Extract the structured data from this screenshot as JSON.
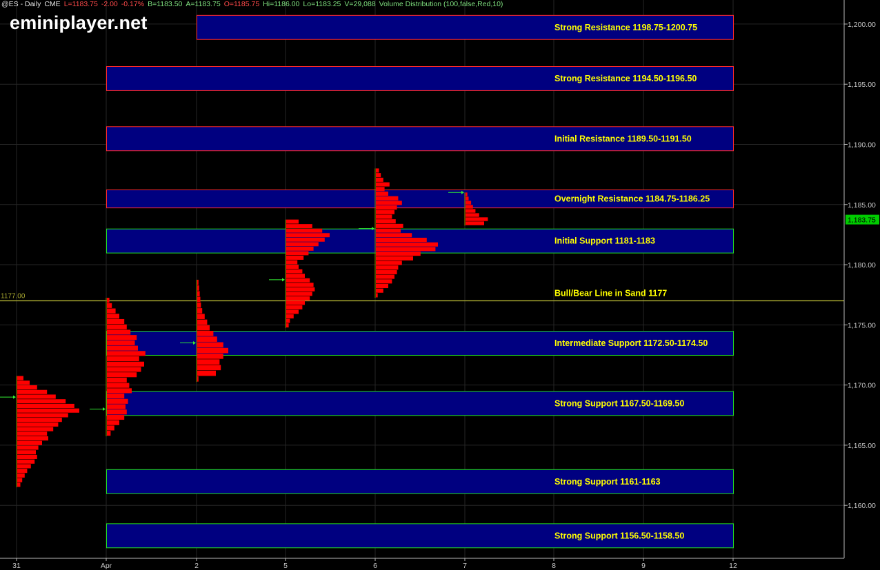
{
  "header": {
    "symbol": "@ES - Daily",
    "exchange": "CME",
    "last": "L=1183.75",
    "change": "-2.00",
    "change_pct": "-0.17%",
    "bid": "B=1183.50",
    "ask": "A=1183.75",
    "open": "O=1185.75",
    "high": "Hi=1186.00",
    "low": "Lo=1183.25",
    "volume": "V=29,088",
    "study": "Volume Distribution (100,false,Red,10)"
  },
  "watermark": "eminiplayer.net",
  "colors": {
    "zone_fill": "#000080",
    "resistance_border": "#ff2a2a",
    "support_border": "#22dd22",
    "zone_text": "#ffff00",
    "profile": "#ff0000",
    "poc_marker": "#33ee33",
    "line_in_sand": "#a8a830",
    "axis_text": "#c8c8c8",
    "last_price_tag": "#00cc00"
  },
  "chart_data": {
    "type": "volume-profile-levels",
    "x_labels": [
      "31",
      "Apr",
      "2",
      "5",
      "6",
      "7",
      "8",
      "9",
      "12"
    ],
    "y_ticks": [
      "1,160.00",
      "1,165.00",
      "1,170.00",
      "1,175.00",
      "1,180.00",
      "1,185.00",
      "1,190.00",
      "1,195.00",
      "1,200.00"
    ],
    "ylim": [
      1155.6,
      1202.0
    ],
    "last_price": 1183.75,
    "last_price_label": "1,183.75",
    "line_in_sand": {
      "value": 1177.0,
      "axis_label": "1177.00",
      "label": "Bull/Bear Line in Sand 1177"
    },
    "zones": [
      {
        "label": "Strong Resistance 1198.75-1200.75",
        "low": 1198.75,
        "high": 1200.75,
        "kind": "resistance",
        "start": "2"
      },
      {
        "label": "Strong Resistance 1194.50-1196.50",
        "low": 1194.5,
        "high": 1196.5,
        "kind": "resistance",
        "start": "Apr"
      },
      {
        "label": "Initial Resistance 1189.50-1191.50",
        "low": 1189.5,
        "high": 1191.5,
        "kind": "resistance",
        "start": "Apr"
      },
      {
        "label": "Overnight Resistance 1184.75-1186.25",
        "low": 1184.75,
        "high": 1186.25,
        "kind": "resistance",
        "start": "Apr"
      },
      {
        "label": "Initial Support 1181-1183",
        "low": 1181,
        "high": 1183,
        "kind": "support",
        "start": "Apr"
      },
      {
        "label": "Intermediate Support 1172.50-1174.50",
        "low": 1172.5,
        "high": 1174.5,
        "kind": "support",
        "start": "Apr"
      },
      {
        "label": "Strong Support 1167.50-1169.50",
        "low": 1167.5,
        "high": 1169.5,
        "kind": "support",
        "start": "Apr"
      },
      {
        "label": "Strong Support 1161-1163",
        "low": 1161,
        "high": 1163,
        "kind": "support",
        "start": "Apr"
      },
      {
        "label": "Strong Support 1156.50-1158.50",
        "low": 1156.5,
        "high": 1158.5,
        "kind": "support",
        "start": "Apr"
      }
    ],
    "profiles": [
      {
        "day": "31",
        "low": 1161.5,
        "high": 1170.75,
        "poc": 1169.0,
        "vol_shape": [
          0.05,
          0.08,
          0.12,
          0.16,
          0.22,
          0.28,
          0.32,
          0.3,
          0.34,
          0.4,
          0.5,
          0.48,
          0.58,
          0.66,
          0.72,
          0.82,
          1.0,
          0.92,
          0.78,
          0.62,
          0.48,
          0.32,
          0.2,
          0.1
        ]
      },
      {
        "day": "Apr",
        "low": 1165.75,
        "high": 1177.25,
        "poc": 1168.0,
        "vol_shape": [
          0.06,
          0.12,
          0.2,
          0.28,
          0.32,
          0.3,
          0.34,
          0.28,
          0.4,
          0.36,
          0.32,
          0.48,
          0.55,
          0.6,
          0.52,
          0.62,
          0.5,
          0.45,
          0.48,
          0.38,
          0.32,
          0.28,
          0.2,
          0.14,
          0.08,
          0.04
        ]
      },
      {
        "day": "2",
        "low": 1170.25,
        "high": 1178.75,
        "poc": 1173.5,
        "vol_shape": [
          0.02,
          0.3,
          0.38,
          0.36,
          0.42,
          0.5,
          0.42,
          0.32,
          0.26,
          0.2,
          0.16,
          0.12,
          0.08,
          0.06,
          0.05,
          0.04,
          0.03,
          0.02
        ]
      },
      {
        "day": "5",
        "low": 1174.75,
        "high": 1183.75,
        "poc": 1178.75,
        "vol_shape": [
          0.04,
          0.06,
          0.12,
          0.2,
          0.26,
          0.3,
          0.38,
          0.42,
          0.46,
          0.44,
          0.38,
          0.3,
          0.26,
          0.2,
          0.18,
          0.28,
          0.36,
          0.44,
          0.52,
          0.62,
          0.7,
          0.58,
          0.42,
          0.2
        ]
      },
      {
        "day": "6",
        "low": 1177.25,
        "high": 1188.0,
        "poc": 1183.0,
        "vol_shape": [
          0.03,
          0.12,
          0.2,
          0.26,
          0.3,
          0.34,
          0.36,
          0.42,
          0.6,
          0.72,
          0.96,
          1.0,
          0.82,
          0.58,
          0.4,
          0.44,
          0.32,
          0.26,
          0.3,
          0.34,
          0.42,
          0.36,
          0.2,
          0.14,
          0.22,
          0.12,
          0.08,
          0.05
        ]
      },
      {
        "day": "7",
        "low": 1183.25,
        "high": 1186.0,
        "poc": 1186.0,
        "vol_shape": [
          0.3,
          0.36,
          0.22,
          0.16,
          0.12,
          0.09,
          0.05,
          0.03
        ]
      }
    ]
  }
}
